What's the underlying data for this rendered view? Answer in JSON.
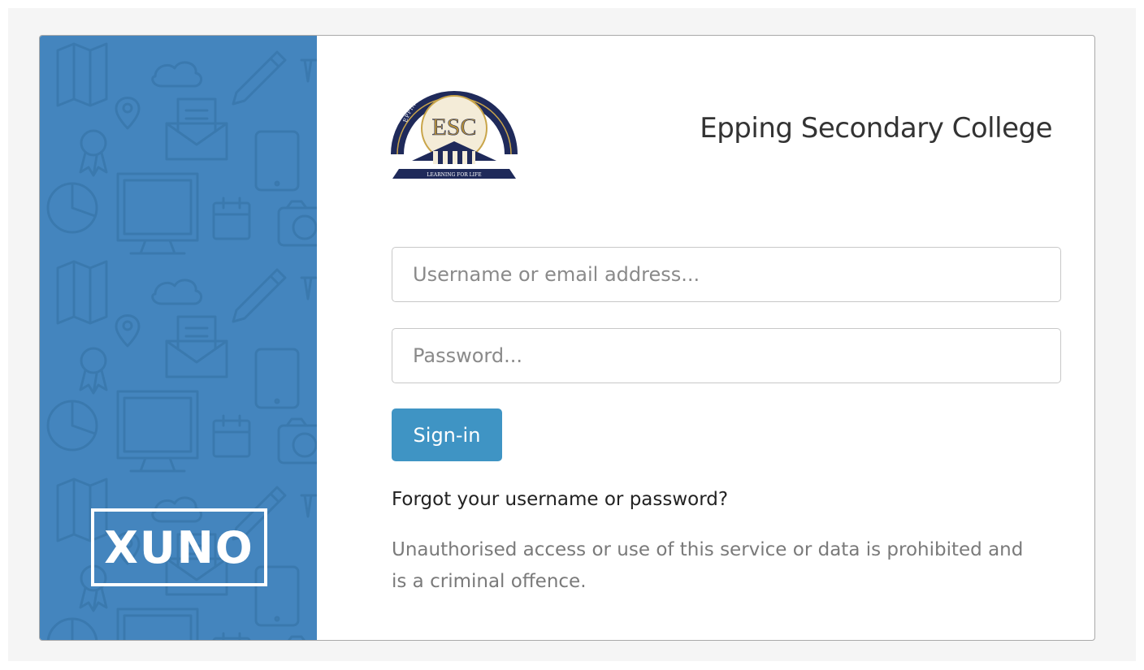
{
  "brand": {
    "logo_text": "XUNO",
    "panel_color": "#4485be"
  },
  "school": {
    "name": "Epping Secondary College",
    "crest": {
      "initials": "ESC",
      "arc_text": "EPPING SECONDARY COLLEGE",
      "motto": "LEARNING FOR LIFE",
      "navy": "#1f2a5a",
      "gold": "#c9a54a"
    }
  },
  "form": {
    "username_placeholder": "Username or email address...",
    "password_placeholder": "Password...",
    "signin_label": "Sign-in",
    "signin_color": "#3f94c4",
    "forgot_link": "Forgot your username or password?",
    "warning": "Unauthorised access or use of this service or data is prohibited and is a criminal offence."
  },
  "background_icons": [
    "map-icon",
    "cloud-icon",
    "pencil-icon",
    "location-pin-icon",
    "envelope-icon",
    "award-icon",
    "tablet-icon",
    "pie-chart-icon",
    "monitor-icon",
    "calendar-icon",
    "camera-icon"
  ]
}
